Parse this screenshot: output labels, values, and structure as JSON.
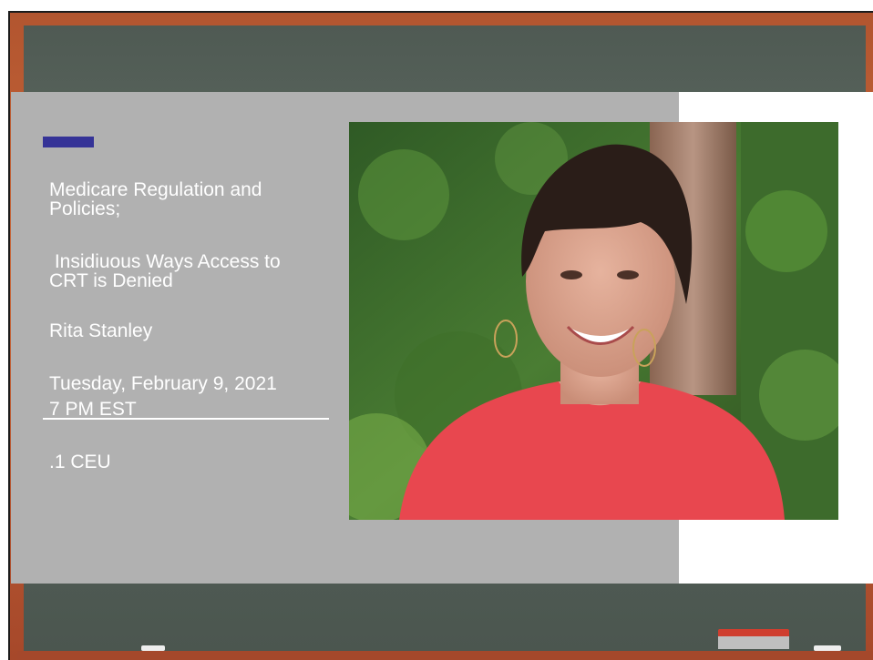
{
  "slide": {
    "title_line1": "Medicare Regulation and",
    "title_line2": "Policies;",
    "subtitle_line1": " Insidiuous Ways Access to",
    "subtitle_line2": "CRT is Denied",
    "presenter": "Rita Stanley",
    "date": "Tuesday, February 9, 2021",
    "time": "7 PM EST",
    "ceu": ".1 CEU"
  },
  "colors": {
    "accent_bar": "#353397",
    "grey_panel": "#b1b1b1",
    "chalkboard": "#57625b",
    "frame_wood": "#b9582f",
    "text": "#ffffff"
  },
  "photo": {
    "subject": "portrait-woman-red-top",
    "background": "forest"
  }
}
